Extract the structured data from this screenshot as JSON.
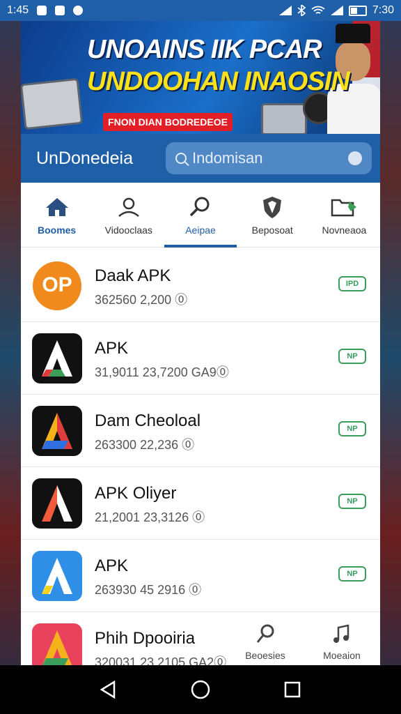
{
  "status_bar": {
    "time": "1:45",
    "right_time": "7:30",
    "icons": [
      "notification-icon",
      "notification-icon",
      "circle-icon",
      "signal-icon",
      "bluetooth-icon",
      "wifi-icon",
      "signal-icon",
      "battery-icon"
    ]
  },
  "banner": {
    "title_line1": "UNOAINS IIK PCAR",
    "title_line2": "UNDOOHAN INAOSIN",
    "button_text": "FNON DIAN BODREDEOE",
    "colors": {
      "bg": "#1a6fc9",
      "title2": "#ffe11a",
      "pill": "#e21f26"
    }
  },
  "header": {
    "app_name": "UnDonedeia",
    "search_placeholder": "Indomisan"
  },
  "tabs": [
    {
      "label": "Boomes",
      "icon": "home-icon"
    },
    {
      "label": "Vidooclaas",
      "icon": "profile-icon"
    },
    {
      "label": "Aeipae",
      "icon": "search-icon",
      "active": true
    },
    {
      "label": "Beposoat",
      "icon": "shield-icon"
    },
    {
      "label": "Novneaoa",
      "icon": "folder-icon"
    }
  ],
  "apps": [
    {
      "name": "Daak APK",
      "meta": "362560 2,200 ⓪",
      "badge": "IPD",
      "icon": "op-logo-icon"
    },
    {
      "name": "APK",
      "meta": "31,9011 23,7200 GA9⓪",
      "badge": "NP",
      "icon": "apk-logo-icon"
    },
    {
      "name": "Dam Cheoloal",
      "meta": "263300 22,236 ⓪",
      "badge": "NP",
      "icon": "apk-logo-icon"
    },
    {
      "name": "APK Oliyer",
      "meta": "21,2001 23,3126 ⓪",
      "badge": "NP",
      "icon": "apk-logo-icon"
    },
    {
      "name": "APK",
      "meta": "263930 45 2916 ⓪",
      "badge": "NP",
      "icon": "apk-logo-icon"
    },
    {
      "name": "Phih Dpooiria",
      "meta": "320031 23,2105 GA2⓪",
      "icon": "apk-logo-icon"
    }
  ],
  "bottom_tabs": [
    {
      "label": "Beoesies",
      "icon": "pin-icon"
    },
    {
      "label": "Moeaion",
      "icon": "music-icon"
    }
  ],
  "nav": {
    "icons": [
      "back-icon",
      "home-icon",
      "recents-icon"
    ]
  },
  "colors": {
    "primary": "#1f5fa8",
    "badge": "#3a9d5a"
  }
}
